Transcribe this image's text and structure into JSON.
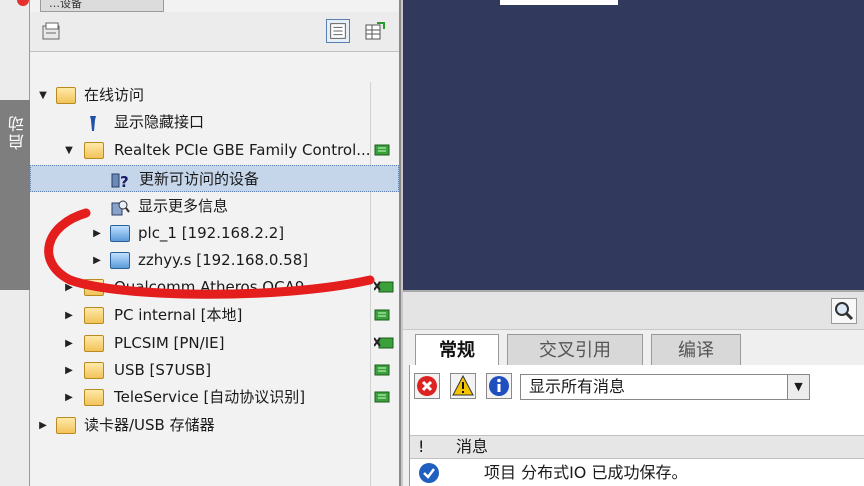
{
  "left_strip": {
    "label": "启动"
  },
  "tree_panel": {
    "tab_label": "…设备",
    "tree": [
      {
        "label": "在线访问",
        "level": 0,
        "expander": "open",
        "icon": "online-access-folder-icon"
      },
      {
        "label": "显示隐藏接口",
        "level": 1,
        "expander": "none",
        "icon": "wrench-icon"
      },
      {
        "label": "Realtek PCIe GBE Family Control...",
        "level": 1,
        "expander": "open",
        "icon": "network-adapter-folder-icon",
        "status_icon": "connected-status-icon"
      },
      {
        "label": "更新可访问的设备",
        "level": 2,
        "expander": "none",
        "icon": "update-devices-icon",
        "selected": true
      },
      {
        "label": "显示更多信息",
        "level": 2,
        "expander": "none",
        "icon": "more-info-icon"
      },
      {
        "label": "plc_1 [192.168.2.2]",
        "level": 2,
        "expander": "closed",
        "icon": "plc-device-icon"
      },
      {
        "label": "zzhyy.s [192.168.0.58]",
        "level": 2,
        "expander": "closed",
        "icon": "plc-device-icon"
      },
      {
        "label": "Qualcomm Atheros QCA9...",
        "level": 1,
        "expander": "closed",
        "icon": "network-adapter-folder-icon",
        "status_icon": "disconnected-status-icon"
      },
      {
        "label": "PC internal [本地]",
        "level": 1,
        "expander": "closed",
        "icon": "network-adapter-folder-icon",
        "status_icon": "connected-status-icon"
      },
      {
        "label": "PLCSIM [PN/IE]",
        "level": 1,
        "expander": "closed",
        "icon": "network-adapter-folder-icon",
        "status_icon": "disconnected-status-icon"
      },
      {
        "label": "USB [S7USB]",
        "level": 1,
        "expander": "closed",
        "icon": "network-adapter-folder-icon",
        "status_icon": "connected-status-icon"
      },
      {
        "label": "TeleService [自动协议识别]",
        "level": 1,
        "expander": "closed",
        "icon": "network-adapter-folder-icon",
        "status_icon": "connected-status-icon"
      },
      {
        "label": "读卡器/USB 存储器",
        "level": 0,
        "expander": "closed",
        "icon": "card-reader-folder-icon"
      }
    ]
  },
  "inspector": {
    "tabs": [
      {
        "label": "常规",
        "active": true
      },
      {
        "label": "交叉引用",
        "active": false
      },
      {
        "label": "编译",
        "active": false
      }
    ],
    "filter_select": "显示所有消息",
    "header": {
      "bang": "!",
      "message": "消息"
    },
    "messages": [
      {
        "text": "项目 分布式IO 已成功保存。",
        "status": "success"
      }
    ]
  },
  "colors": {
    "canvas": "#313a5c",
    "annotation_stroke": "#e41d1d",
    "selection": "#c5d6ea"
  }
}
